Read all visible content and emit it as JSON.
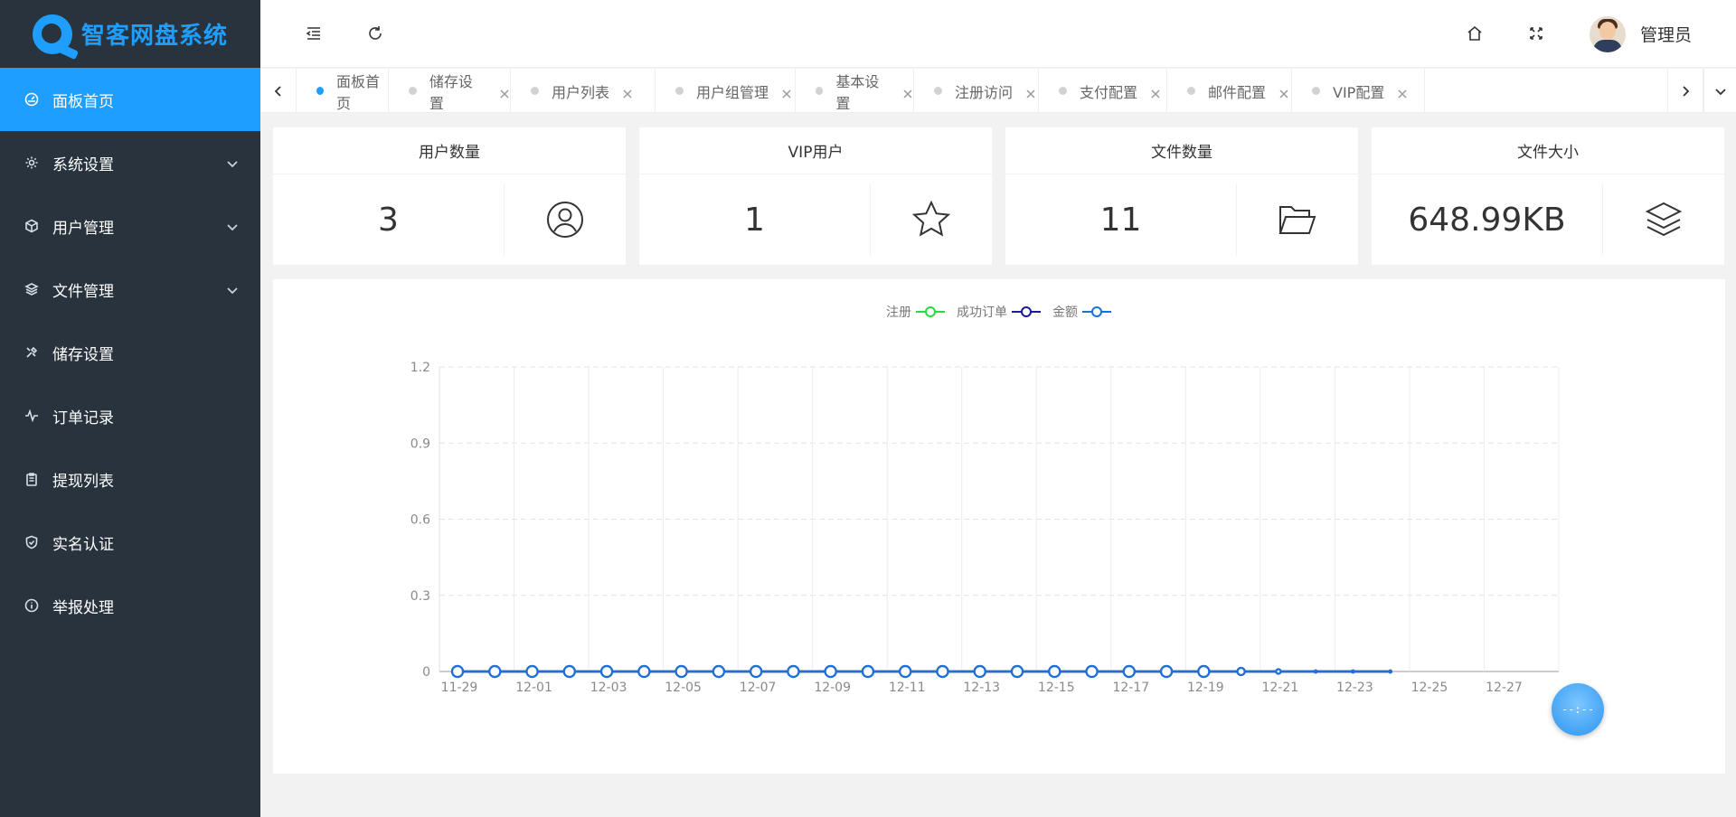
{
  "app": {
    "logo_text": "智客网盘系统"
  },
  "sidebar": {
    "items": [
      {
        "label": "面板首页",
        "icon": "dashboard-icon",
        "active": true,
        "has_arrow": false
      },
      {
        "label": "系统设置",
        "icon": "gear-icon",
        "active": false,
        "has_arrow": true
      },
      {
        "label": "用户管理",
        "icon": "cube-icon",
        "active": false,
        "has_arrow": true
      },
      {
        "label": "文件管理",
        "icon": "layers-icon",
        "active": false,
        "has_arrow": true
      },
      {
        "label": "储存设置",
        "icon": "tools-icon",
        "active": false,
        "has_arrow": false
      },
      {
        "label": "订单记录",
        "icon": "pulse-icon",
        "active": false,
        "has_arrow": false
      },
      {
        "label": "提现列表",
        "icon": "clipboard-icon",
        "active": false,
        "has_arrow": false
      },
      {
        "label": "实名认证",
        "icon": "shield-check-icon",
        "active": false,
        "has_arrow": false
      },
      {
        "label": "举报处理",
        "icon": "info-icon",
        "active": false,
        "has_arrow": false
      }
    ]
  },
  "header": {
    "admin_name": "管理员"
  },
  "tabs": [
    {
      "label": "面板首页",
      "active": true,
      "closable": false
    },
    {
      "label": "储存设置",
      "active": false,
      "closable": true
    },
    {
      "label": "用户列表",
      "active": false,
      "closable": true
    },
    {
      "label": "用户组管理",
      "active": false,
      "closable": true
    },
    {
      "label": "基本设置",
      "active": false,
      "closable": true
    },
    {
      "label": "注册访问",
      "active": false,
      "closable": true
    },
    {
      "label": "支付配置",
      "active": false,
      "closable": true
    },
    {
      "label": "邮件配置",
      "active": false,
      "closable": true
    },
    {
      "label": "VIP配置",
      "active": false,
      "closable": true
    }
  ],
  "cards": [
    {
      "title": "用户数量",
      "value": "3",
      "icon": "user-circle-icon"
    },
    {
      "title": "VIP用户",
      "value": "1",
      "icon": "star-icon"
    },
    {
      "title": "文件数量",
      "value": "11",
      "icon": "folder-open-icon"
    },
    {
      "title": "文件大小",
      "value": "648.99KB",
      "icon": "layers-icon"
    }
  ],
  "chart_data": {
    "type": "line",
    "legend": [
      {
        "name": "注册",
        "color": "#22dd44"
      },
      {
        "name": "成功订单",
        "color": "#1a1aa0"
      },
      {
        "name": "金额",
        "color": "#1e6fd9"
      }
    ],
    "x_ticks": [
      "11-29",
      "12-01",
      "12-03",
      "12-05",
      "12-07",
      "12-09",
      "12-11",
      "12-13",
      "12-15",
      "12-17",
      "12-19",
      "12-21",
      "12-23",
      "12-25",
      "12-27"
    ],
    "x_start": "11-29",
    "x_end": "12-29",
    "y_ticks": [
      "0",
      "0.3",
      "0.6",
      "0.9",
      "1.2"
    ],
    "ylim": [
      0,
      1.2
    ],
    "series_x": [
      "11-29",
      "11-30",
      "12-01",
      "12-02",
      "12-03",
      "12-04",
      "12-05",
      "12-06",
      "12-07",
      "12-08",
      "12-09",
      "12-10",
      "12-11",
      "12-12",
      "12-13",
      "12-14",
      "12-15",
      "12-16",
      "12-17",
      "12-18",
      "12-19",
      "12-20",
      "12-21",
      "12-22",
      "12-23",
      "12-24"
    ],
    "series": [
      {
        "name": "注册",
        "values": [
          0,
          0,
          0,
          0,
          0,
          0,
          0,
          0,
          0,
          0,
          0,
          0,
          0,
          0,
          0,
          0,
          0,
          0,
          0,
          0,
          0,
          0,
          0,
          0,
          0,
          0
        ]
      },
      {
        "name": "成功订单",
        "values": [
          0,
          0,
          0,
          0,
          0,
          0,
          0,
          0,
          0,
          0,
          0,
          0,
          0,
          0,
          0,
          0,
          0,
          0,
          0,
          0,
          0,
          0,
          0,
          0,
          0,
          0
        ]
      },
      {
        "name": "金额",
        "values": [
          0,
          0,
          0,
          0,
          0,
          0,
          0,
          0,
          0,
          0,
          0,
          0,
          0,
          0,
          0,
          0,
          0,
          0,
          0,
          0,
          0,
          0,
          0,
          0,
          0,
          0
        ]
      }
    ],
    "grid": true
  }
}
